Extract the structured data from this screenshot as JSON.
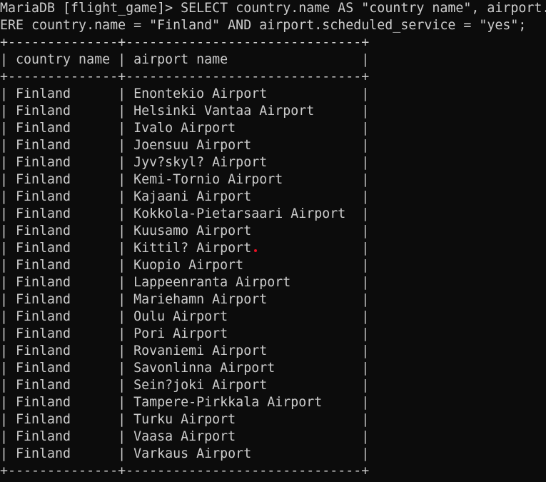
{
  "prompt": "MariaDB [flight_game]>",
  "query_line1": "SELECT country.name AS \"country name\", airport.",
  "query_line2": "ERE country.name = \"Finland\" AND airport.scheduled_service = \"yes\";",
  "table": {
    "border": "+--------------+------------------------------+",
    "headers": [
      "country name",
      "airport name"
    ],
    "rows": [
      [
        "Finland",
        "Enontekio Airport"
      ],
      [
        "Finland",
        "Helsinki Vantaa Airport"
      ],
      [
        "Finland",
        "Ivalo Airport"
      ],
      [
        "Finland",
        "Joensuu Airport"
      ],
      [
        "Finland",
        "Jyv?skyl? Airport"
      ],
      [
        "Finland",
        "Kemi-Tornio Airport"
      ],
      [
        "Finland",
        "Kajaani Airport"
      ],
      [
        "Finland",
        "Kokkola-Pietarsaari Airport"
      ],
      [
        "Finland",
        "Kuusamo Airport"
      ],
      [
        "Finland",
        "Kittil? Airport"
      ],
      [
        "Finland",
        "Kuopio Airport"
      ],
      [
        "Finland",
        "Lappeenranta Airport"
      ],
      [
        "Finland",
        "Mariehamn Airport"
      ],
      [
        "Finland",
        "Oulu Airport"
      ],
      [
        "Finland",
        "Pori Airport"
      ],
      [
        "Finland",
        "Rovaniemi Airport"
      ],
      [
        "Finland",
        "Savonlinna Airport"
      ],
      [
        "Finland",
        "Sein?joki Airport"
      ],
      [
        "Finland",
        "Tampere-Pirkkala Airport"
      ],
      [
        "Finland",
        "Turku Airport"
      ],
      [
        "Finland",
        "Vaasa Airport"
      ],
      [
        "Finland",
        "Varkaus Airport"
      ]
    ]
  },
  "colors": {
    "background": "#0c0c0c",
    "text": "#cccccc",
    "cursor": "#e81123"
  }
}
